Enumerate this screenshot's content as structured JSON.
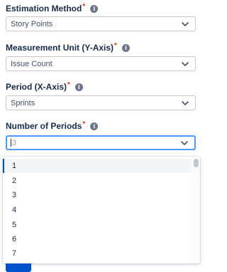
{
  "estimation": {
    "label": "Estimation Method",
    "required_mark": "*",
    "info": "i",
    "value": "Story Points"
  },
  "measurement": {
    "label": "Measurement Unit (Y-Axis)",
    "required_mark": "*",
    "info": "i",
    "value": "Issue Count"
  },
  "period": {
    "label": "Period (X-Axis)",
    "required_mark": "*",
    "info": "i",
    "value": "Sprints"
  },
  "num_periods": {
    "label": "Number of Periods",
    "required_mark": "*",
    "info": "i",
    "value": "3"
  },
  "dropdown": {
    "options": [
      "1",
      "2",
      "3",
      "4",
      "5",
      "6",
      "7"
    ],
    "focused_option": "1"
  },
  "colors": {
    "accent": "#0052CC",
    "focus_border": "#4C9AFF",
    "required": "#DE350B",
    "text": "#172B4D"
  }
}
